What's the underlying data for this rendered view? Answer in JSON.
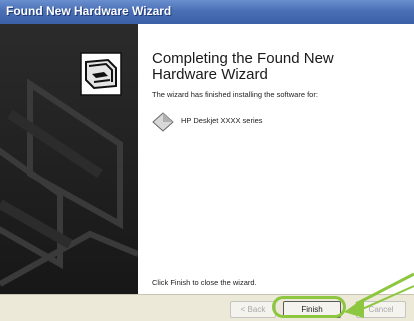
{
  "window": {
    "title": "Found New Hardware Wizard"
  },
  "content": {
    "heading": "Completing the Found New Hardware Wizard",
    "info": "The wizard has finished installing the software for:",
    "device_name": "HP Deskjet XXXX series",
    "close_instruction": "Click Finish to close the wizard."
  },
  "buttons": {
    "back": "< Back",
    "finish": "Finish",
    "cancel": "Cancel"
  },
  "icons": {
    "wizard": "hardware-install-icon",
    "device": "device-diamond-icon",
    "pointer": "callout-arrow-icon"
  },
  "colors": {
    "titlebar": "#4a6fb5",
    "highlight": "#8dc63f",
    "left_panel": "#1f1f1f"
  }
}
